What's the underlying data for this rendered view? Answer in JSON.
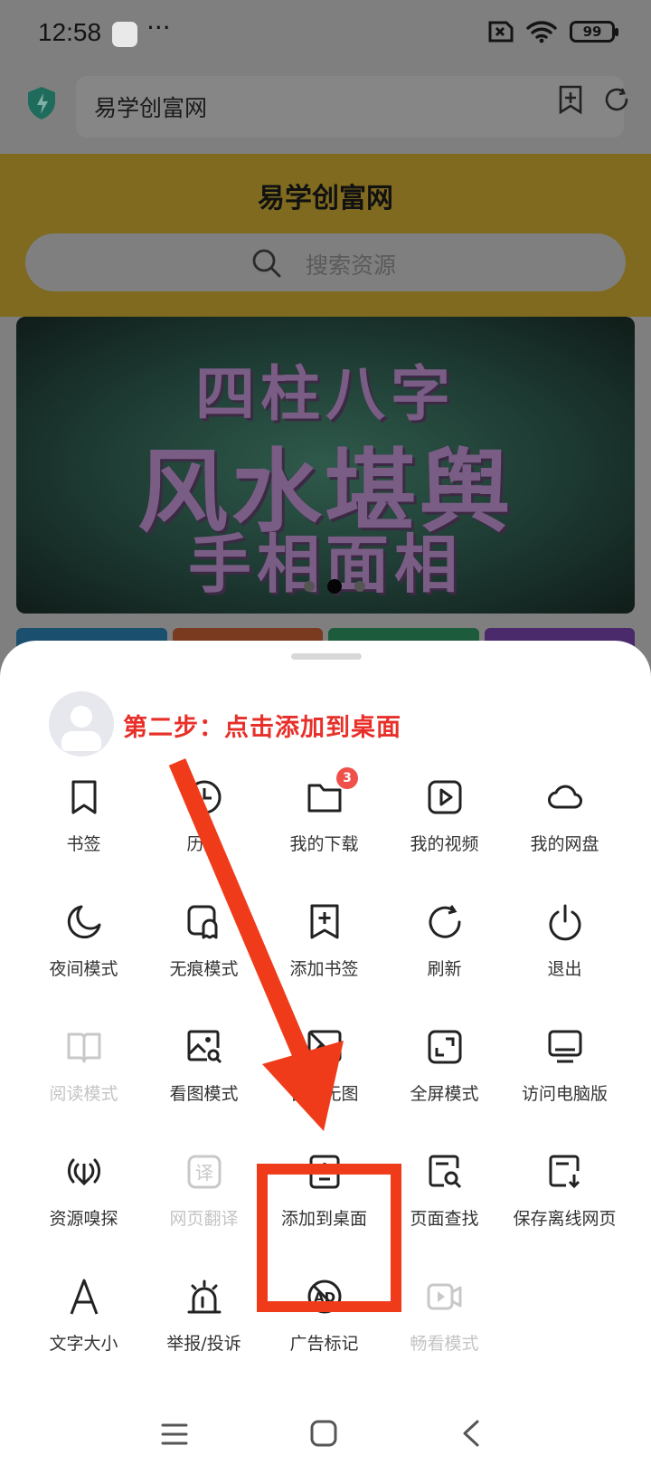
{
  "status_bar": {
    "time": "12:58",
    "more": "···",
    "battery": "99"
  },
  "address_bar": {
    "url_text": "易学创富网"
  },
  "site": {
    "title": "易学创富网",
    "search_placeholder": "搜索资源",
    "banner_lines": [
      "四柱八字",
      "风水堪舆",
      "手相面相"
    ],
    "carousel_total": 3,
    "carousel_active": 2
  },
  "sheet": {
    "instruction": "第二步：点击添加到桌面",
    "rows": [
      [
        {
          "label": "书签",
          "icon": "bookmark-icon",
          "dim": false
        },
        {
          "label": "历史",
          "icon": "history-icon",
          "dim": false
        },
        {
          "label": "我的下载",
          "icon": "folder-icon",
          "dim": false,
          "badge": "3"
        },
        {
          "label": "我的视频",
          "icon": "video-icon",
          "dim": false
        },
        {
          "label": "我的网盘",
          "icon": "cloud-icon",
          "dim": false
        }
      ],
      [
        {
          "label": "夜间模式",
          "icon": "moon-icon",
          "dim": false
        },
        {
          "label": "无痕模式",
          "icon": "ghost-icon",
          "dim": false
        },
        {
          "label": "添加书签",
          "icon": "bookmark-add-icon",
          "dim": false
        },
        {
          "label": "刷新",
          "icon": "refresh-icon",
          "dim": false
        },
        {
          "label": "退出",
          "icon": "power-icon",
          "dim": false
        }
      ],
      [
        {
          "label": "阅读模式",
          "icon": "book-icon",
          "dim": true
        },
        {
          "label": "看图模式",
          "icon": "image-search-icon",
          "dim": false
        },
        {
          "label": "智能无图",
          "icon": "no-image-icon",
          "dim": false
        },
        {
          "label": "全屏模式",
          "icon": "fullscreen-icon",
          "dim": false
        },
        {
          "label": "访问电脑版",
          "icon": "monitor-icon",
          "dim": false
        }
      ],
      [
        {
          "label": "资源嗅探",
          "icon": "sniff-icon",
          "dim": false
        },
        {
          "label": "网页翻译",
          "icon": "translate-icon",
          "dim": true
        },
        {
          "label": "添加到桌面",
          "icon": "add-to-desktop-icon",
          "dim": false
        },
        {
          "label": "页面查找",
          "icon": "page-search-icon",
          "dim": false
        },
        {
          "label": "保存离线网页",
          "icon": "save-offline-icon",
          "dim": false
        }
      ],
      [
        {
          "label": "文字大小",
          "icon": "font-size-icon",
          "dim": false
        },
        {
          "label": "举报/投诉",
          "icon": "alarm-icon",
          "dim": false
        },
        {
          "label": "广告标记",
          "icon": "ad-block-icon",
          "dim": false
        },
        {
          "label": "畅看模式",
          "icon": "smooth-video-icon",
          "dim": true
        }
      ]
    ]
  },
  "colors": {
    "annotation_red": "#f03b1b",
    "instruction_red": "#e8302a",
    "badge_red": "#f0504a",
    "dim_text": "#c4c4c4"
  }
}
